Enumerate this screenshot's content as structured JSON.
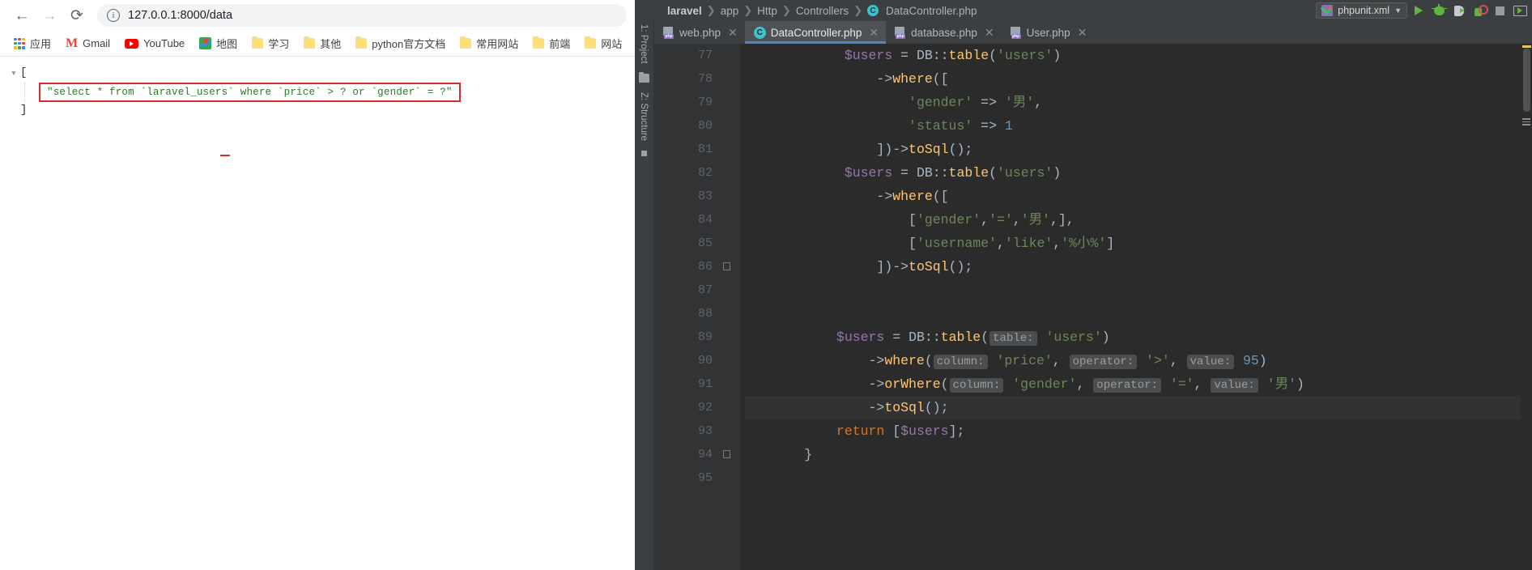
{
  "browser": {
    "nav": {
      "back_icon": "back-arrow-icon",
      "forward_icon": "forward-arrow-icon",
      "reload_icon": "reload-icon"
    },
    "omnibox": {
      "url": "127.0.0.1:8000/data",
      "info_icon": "page-info-icon"
    },
    "bookmarks": [
      {
        "label": "应用",
        "icon": "apps-grid-icon"
      },
      {
        "label": "Gmail",
        "icon": "gmail-icon"
      },
      {
        "label": "YouTube",
        "icon": "youtube-icon"
      },
      {
        "label": "地图",
        "icon": "google-maps-icon"
      },
      {
        "label": "学习",
        "icon": "folder-icon"
      },
      {
        "label": "其他",
        "icon": "folder-icon"
      },
      {
        "label": "python官方文档",
        "icon": "folder-icon"
      },
      {
        "label": "常用网站",
        "icon": "folder-icon"
      },
      {
        "label": "前端",
        "icon": "folder-icon"
      },
      {
        "label": "网站",
        "icon": "folder-icon"
      }
    ],
    "json": {
      "collapse_triangle": "▼",
      "open_bracket": "[",
      "close_bracket": "]",
      "sql_string": "\"select * from `laravel_users` where `price` > ? or `gender` = ?\"",
      "highlight_color": "#d32f2f",
      "string_color": "#2a7a2a"
    }
  },
  "ide": {
    "breadcrumbs": [
      {
        "label": "laravel",
        "bold": true
      },
      {
        "label": "app",
        "bold": false
      },
      {
        "label": "Http",
        "bold": false
      },
      {
        "label": "Controllers",
        "bold": false
      },
      {
        "label": "DataController.php",
        "bold": false,
        "icon": "php-class-icon",
        "icon_letter": "C"
      }
    ],
    "breadcrumb_separator": "❯",
    "run_config": {
      "name": "phpunit.xml",
      "icon": "phpunit-config-icon",
      "dropdown_icon": "chevron-down-icon"
    },
    "toolbar_buttons": [
      {
        "name": "run-button",
        "icon": "play-icon"
      },
      {
        "name": "debug-button",
        "icon": "bug-icon"
      },
      {
        "name": "run-with-profiler-button",
        "icon": "profiler-icon"
      },
      {
        "name": "run-with-coverage-button",
        "icon": "coverage-icon"
      },
      {
        "name": "stop-button",
        "icon": "stop-square-icon"
      },
      {
        "name": "terminal-button",
        "icon": "terminal-icon"
      }
    ],
    "tool_windows": [
      {
        "label": "1: Project"
      },
      {
        "label": "Z: Structure"
      }
    ],
    "tabs": [
      {
        "label": "web.php",
        "icon": "php-file-icon",
        "active": false,
        "close_icon": "close-icon"
      },
      {
        "label": "DataController.php",
        "icon": "php-class-icon",
        "icon_letter": "C",
        "active": true,
        "close_icon": "close-icon"
      },
      {
        "label": "database.php",
        "icon": "php-file-icon",
        "active": false,
        "close_icon": "close-icon"
      },
      {
        "label": "User.php",
        "icon": "php-file-icon",
        "active": false,
        "close_icon": "close-icon"
      }
    ],
    "editor": {
      "first_line_number": 77,
      "highlighted_line": 92,
      "lines": [
        {
          "n": 77,
          "indent": 12,
          "html": "<span class=\"tok-var\">$users</span> = <span class=\"tok-cls\">DB</span>::<span class=\"tok-fn\">table</span>(<span class=\"tok-str\">'users'</span>)",
          "fold": false
        },
        {
          "n": 78,
          "indent": 16,
          "html": "-&gt;<span class=\"tok-fn\">where</span>([",
          "fold": false
        },
        {
          "n": 79,
          "indent": 20,
          "html": "<span class=\"tok-str\">'gender'</span> =&gt; <span class=\"tok-str\">'男'</span>,",
          "fold": false
        },
        {
          "n": 80,
          "indent": 20,
          "html": "<span class=\"tok-str\">'status'</span> =&gt; <span class=\"tok-num\">1</span>",
          "fold": false
        },
        {
          "n": 81,
          "indent": 16,
          "html": "])-&gt;<span class=\"tok-fn\">toSql</span>();",
          "fold": false
        },
        {
          "n": 82,
          "indent": 12,
          "html": "<span class=\"tok-var\">$users</span> = <span class=\"tok-cls\">DB</span>::<span class=\"tok-fn\">table</span>(<span class=\"tok-str\">'users'</span>)",
          "fold": false
        },
        {
          "n": 83,
          "indent": 16,
          "html": "-&gt;<span class=\"tok-fn\">where</span>([",
          "fold": false
        },
        {
          "n": 84,
          "indent": 20,
          "html": "[<span class=\"tok-str\">'gender'</span>,<span class=\"tok-str\">'='</span>,<span class=\"tok-str\">'男'</span>,],",
          "fold": false
        },
        {
          "n": 85,
          "indent": 20,
          "html": "[<span class=\"tok-str\">'username'</span>,<span class=\"tok-str\">'like'</span>,<span class=\"tok-str\">'%小%'</span>]",
          "fold": false
        },
        {
          "n": 86,
          "indent": 16,
          "html": "])-&gt;<span class=\"tok-fn\">toSql</span>();",
          "fold": true
        },
        {
          "n": 87,
          "indent": 0,
          "html": "",
          "fold": false
        },
        {
          "n": 88,
          "indent": 0,
          "html": "",
          "fold": false
        },
        {
          "n": 89,
          "indent": 11,
          "html": "<span class=\"tok-var\">$users</span> = <span class=\"tok-cls\">DB</span>::<span class=\"tok-fn\">table</span>(<span class=\"hint\">table:</span> <span class=\"tok-str\">'users'</span>)",
          "fold": false
        },
        {
          "n": 90,
          "indent": 15,
          "html": "-&gt;<span class=\"tok-fn\">where</span>(<span class=\"hint\">column:</span> <span class=\"tok-str\">'price'</span>, <span class=\"hint\">operator:</span> <span class=\"tok-str\">'&gt;'</span>, <span class=\"hint\">value:</span> <span class=\"tok-num\">95</span>)",
          "fold": false
        },
        {
          "n": 91,
          "indent": 15,
          "html": "-&gt;<span class=\"tok-fn\">orWhere</span>(<span class=\"hint\">column:</span> <span class=\"tok-str\">'gender'</span>, <span class=\"hint\">operator:</span> <span class=\"tok-str\">'='</span>, <span class=\"hint\">value:</span> <span class=\"tok-str\">'男'</span>)",
          "fold": false
        },
        {
          "n": 92,
          "indent": 15,
          "html": "-&gt;<span class=\"tok-fn\">toSql</span>();",
          "fold": false
        },
        {
          "n": 93,
          "indent": 11,
          "html": "<span class=\"tok-kw\">return</span> [<span class=\"tok-var\">$users</span>];",
          "fold": false
        },
        {
          "n": 94,
          "indent": 7,
          "html": "}",
          "fold": true
        },
        {
          "n": 95,
          "indent": 0,
          "html": "",
          "fold": false
        }
      ]
    },
    "colors": {
      "editor_bg": "#2b2b2b",
      "gutter_bg": "#313335",
      "chrome_bg": "#3c3f41",
      "active_tab_underline": "#4a88c7",
      "string": "#6a8759",
      "function": "#ffc66d",
      "variable": "#9876aa",
      "number": "#6897bb",
      "keyword": "#cc7832"
    }
  }
}
